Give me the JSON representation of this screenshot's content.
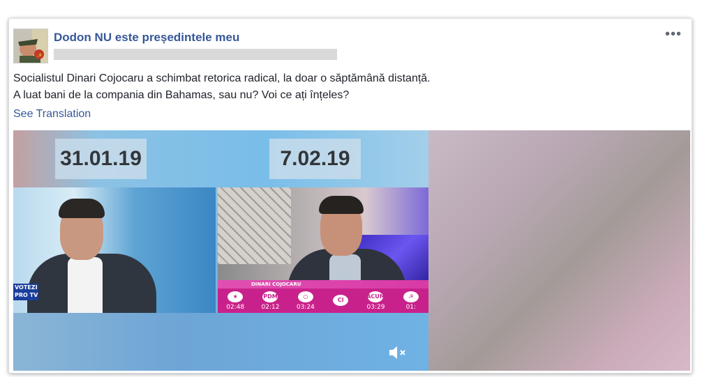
{
  "post": {
    "page_name": "Dodon NU este președintele meu",
    "text_lines": [
      "Socialistul Dinari Cojocaru a schimbat retorica radical, la doar o săptămână distanță.",
      "A luat bani de la compania din Bahamas, sau nu? Voi ce ați înțeles?"
    ],
    "see_translation": "See Translation",
    "more_icon": "ellipsis-icon"
  },
  "video": {
    "date_left": "31.01.19",
    "date_right": "7.02.19",
    "left_panel": {
      "logo_line1": "VOTEZI",
      "logo_line2": "PRO TV"
    },
    "right_panel": {
      "lower_third_name": "DINARI COJOCARU",
      "scores": [
        {
          "logo": "★",
          "time": "02:48"
        },
        {
          "logo": "PDM",
          "time": "02:12"
        },
        {
          "logo": "○",
          "time": "03:24"
        },
        {
          "logo": "CI",
          "time": ""
        },
        {
          "logo": "ACUM",
          "time": "03:29"
        },
        {
          "logo": "☭",
          "time": "01:"
        }
      ]
    },
    "mute_icon": "muted-speaker-icon"
  }
}
